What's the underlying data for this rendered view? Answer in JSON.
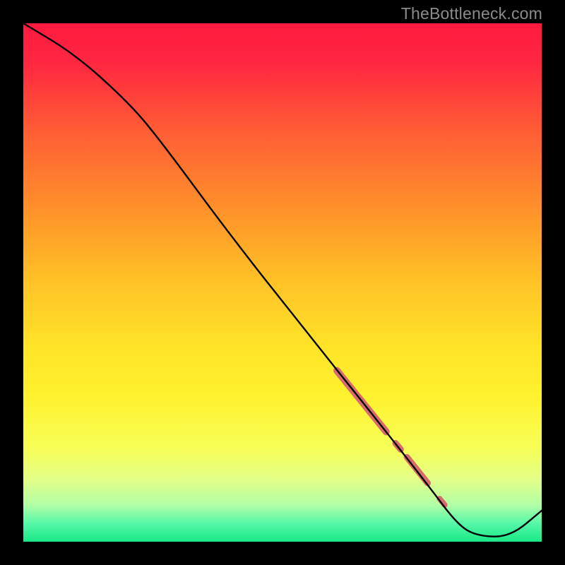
{
  "watermark": "TheBottleneck.com",
  "colors": {
    "frame": "#000000",
    "gradient_stops": [
      {
        "offset": 0.0,
        "color": "#ff1a3f"
      },
      {
        "offset": 0.08,
        "color": "#ff2840"
      },
      {
        "offset": 0.2,
        "color": "#ff5a35"
      },
      {
        "offset": 0.35,
        "color": "#ff8e2a"
      },
      {
        "offset": 0.5,
        "color": "#ffc326"
      },
      {
        "offset": 0.62,
        "color": "#ffe328"
      },
      {
        "offset": 0.72,
        "color": "#fff22e"
      },
      {
        "offset": 0.82,
        "color": "#f7ff57"
      },
      {
        "offset": 0.88,
        "color": "#e3ff88"
      },
      {
        "offset": 0.93,
        "color": "#b0ffa6"
      },
      {
        "offset": 0.965,
        "color": "#55f8a8"
      },
      {
        "offset": 1.0,
        "color": "#18e884"
      }
    ],
    "curve": "#000000",
    "highlight": "#d86b6b"
  },
  "chart_data": {
    "type": "line",
    "title": "",
    "xlabel": "",
    "ylabel": "",
    "xlim": [
      0,
      100
    ],
    "ylim": [
      0,
      100
    ],
    "series": [
      {
        "name": "bottleneck-curve",
        "x": [
          0,
          10,
          20,
          26,
          40,
          55,
          67,
          78,
          84,
          88,
          94,
          100
        ],
        "y": [
          100,
          94,
          85,
          78,
          59,
          40,
          25,
          11,
          3,
          1,
          1,
          6
        ]
      }
    ],
    "highlight_segments": [
      {
        "x0": 60.5,
        "y0": 33.0,
        "x1": 70.0,
        "y1": 21.2,
        "width": 10
      },
      {
        "x0": 71.8,
        "y0": 19.0,
        "x1": 72.8,
        "y1": 17.8,
        "width": 9
      },
      {
        "x0": 74.0,
        "y0": 16.3,
        "x1": 78.0,
        "y1": 11.3,
        "width": 9
      },
      {
        "x0": 80.3,
        "y0": 8.3,
        "x1": 81.3,
        "y1": 7.1,
        "width": 8
      }
    ]
  }
}
